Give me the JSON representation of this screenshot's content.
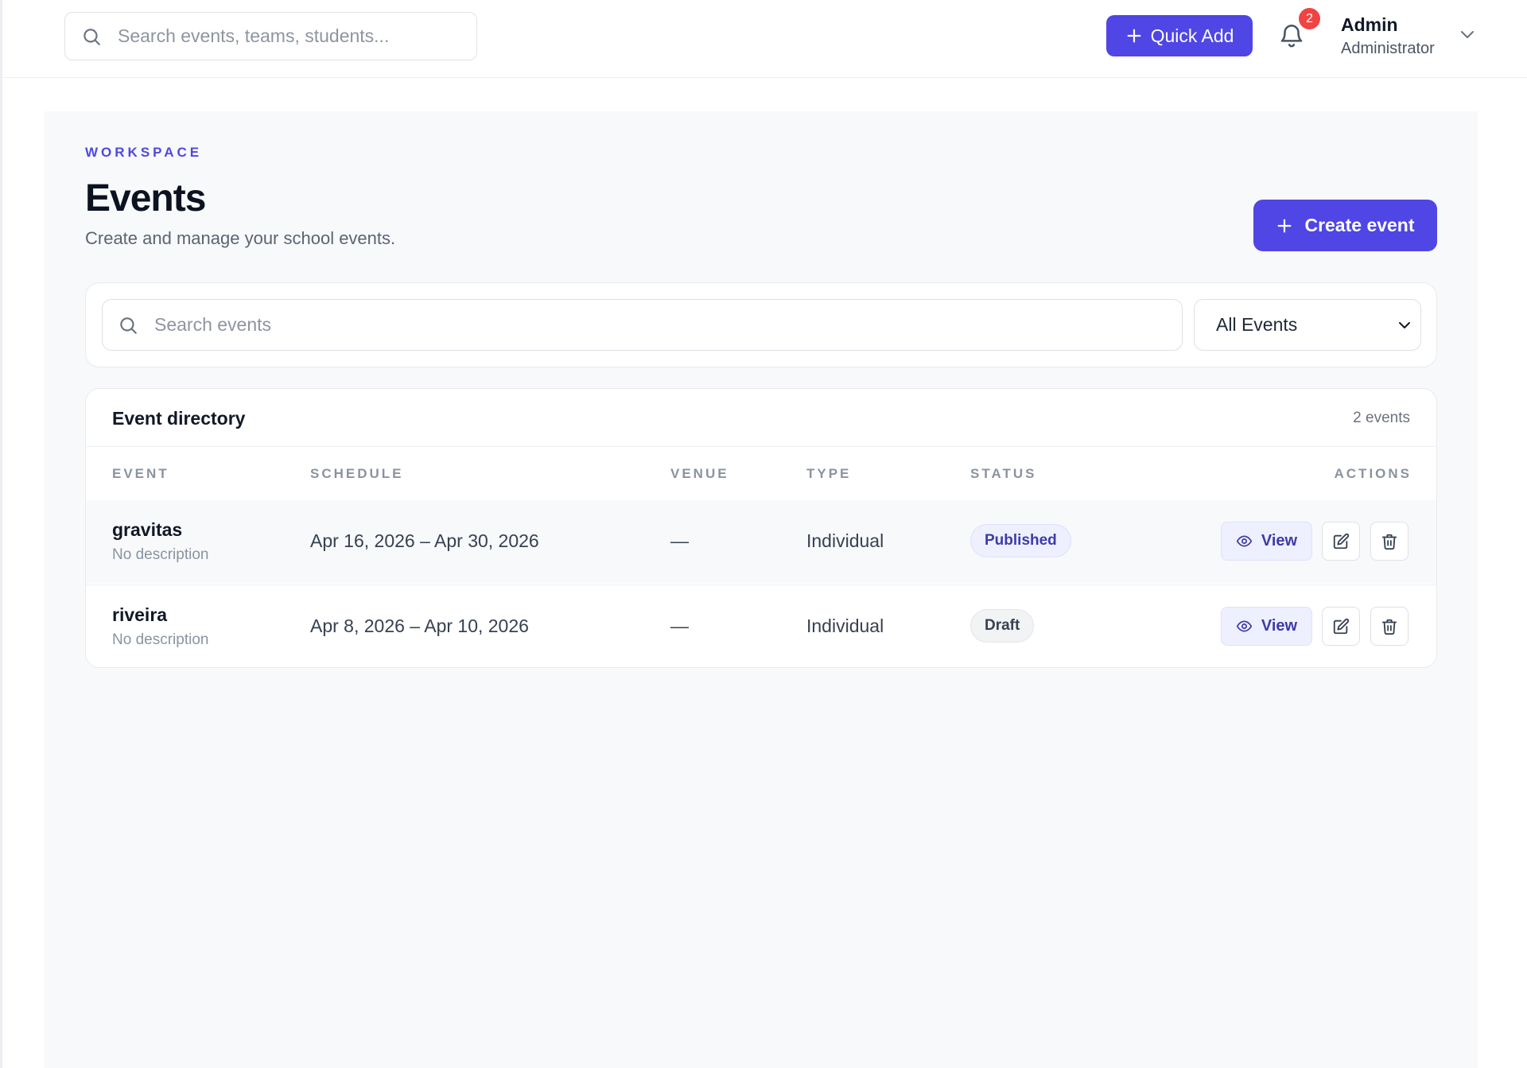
{
  "topbar": {
    "search_placeholder": "Search events, teams, students...",
    "quick_add_label": "Quick Add",
    "notification_count": "2",
    "user_name": "Admin",
    "user_role": "Administrator"
  },
  "page": {
    "eyebrow": "WORKSPACE",
    "title": "Events",
    "subtitle": "Create and manage your school events.",
    "create_label": "Create event"
  },
  "filters": {
    "search_placeholder": "Search events",
    "select_value": "All Events"
  },
  "directory": {
    "title": "Event directory",
    "count": "2 events",
    "columns": [
      "EVENT",
      "SCHEDULE",
      "VENUE",
      "TYPE",
      "STATUS",
      "ACTIONS"
    ],
    "rows": [
      {
        "name": "gravitas",
        "description": "No description",
        "schedule": "Apr 16, 2026 – Apr 30, 2026",
        "venue": "—",
        "type": "Individual",
        "status": "Published",
        "view_label": "View"
      },
      {
        "name": "riveira",
        "description": "No description",
        "schedule": "Apr 8, 2026 – Apr 10, 2026",
        "venue": "—",
        "type": "Individual",
        "status": "Draft",
        "view_label": "View"
      }
    ]
  },
  "colors": {
    "accent": "#4f46e5",
    "badge": "#ef4444",
    "background": "#f8f9fb"
  }
}
